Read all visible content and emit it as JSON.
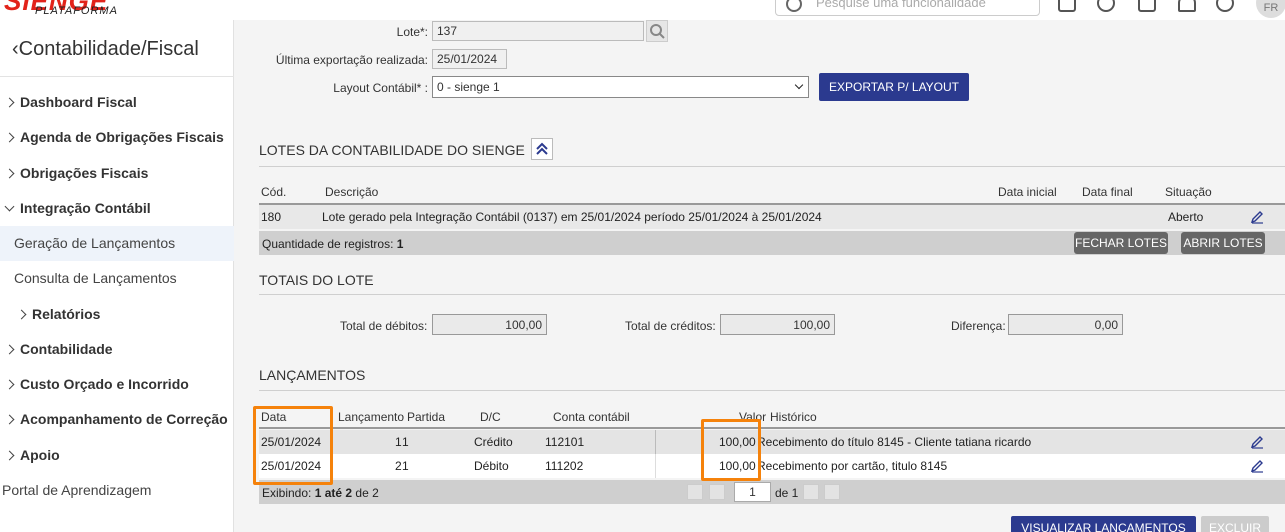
{
  "topbar": {
    "brand": "SIENGE",
    "brand_sub": "PLATAFORMA",
    "search_placeholder": "Pesquise uma funcionalidade",
    "avatar_initials": "FR"
  },
  "sidebar": {
    "title": "Contabilidade/Fiscal",
    "items": [
      {
        "label": "Dashboard Fiscal"
      },
      {
        "label": "Agenda de Obrigações Fiscais"
      },
      {
        "label": "Obrigações Fiscais"
      },
      {
        "label": "Integração Contábil"
      },
      {
        "label": "Geração de Lançamentos"
      },
      {
        "label": "Consulta de Lançamentos"
      },
      {
        "label": "Relatórios"
      },
      {
        "label": "Contabilidade"
      },
      {
        "label": "Custo Orçado e Incorrido"
      },
      {
        "label": "Acompanhamento de Correção"
      },
      {
        "label": "Apoio"
      },
      {
        "label": "Portal de Aprendizagem"
      }
    ]
  },
  "form": {
    "lote_label": "Lote*:",
    "lote_value": "137",
    "ultima_label": "Última exportação realizada:",
    "ultima_value": "25/01/2024",
    "layout_label": "Layout Contábil* :",
    "layout_value": "0 - sienge 1",
    "export_button": "EXPORTAR P/ LAYOUT"
  },
  "lotes": {
    "title": "LOTES DA CONTABILIDADE DO SIENGE",
    "headers": [
      "Cód.",
      "Descrição",
      "Data inicial",
      "Data final",
      "Situação"
    ],
    "row": {
      "cod": "180",
      "descricao": "Lote gerado pela Integração Contábil (0137) em 25/01/2024 período 25/01/2024 à 25/01/2024",
      "situacao": "Aberto"
    },
    "count_label": "Quantidade de registros:",
    "count_value": "1",
    "fechar_button": "FECHAR LOTES",
    "abrir_button": "ABRIR LOTES"
  },
  "totais": {
    "title": "TOTAIS DO LOTE",
    "debitos_label": "Total de débitos:",
    "debitos_value": "100,00",
    "creditos_label": "Total de créditos:",
    "creditos_value": "100,00",
    "diferenca_label": "Diferença:",
    "diferenca_value": "0,00"
  },
  "lancamentos": {
    "title": "LANÇAMENTOS",
    "headers": [
      "Data",
      "Lançamento",
      "Partida",
      "D/C",
      "Conta contábil",
      "Valor",
      "Histórico"
    ],
    "rows": [
      {
        "data": "25/01/2024",
        "lancamento": "1",
        "partida": "1",
        "dc": "Crédito",
        "conta": "112101",
        "valor": "100,00",
        "historico": "Recebimento do título 8145 - Cliente tatiana ricardo"
      },
      {
        "data": "25/01/2024",
        "lancamento": "2",
        "partida": "1",
        "dc": "Débito",
        "conta": "111202",
        "valor": "100,00",
        "historico": "Recebimento por cartão, titulo 8145"
      }
    ],
    "showing_prefix": "Exibindo:",
    "showing_range": "1 até 2",
    "showing_of": "de 2",
    "page_value": "1",
    "page_of": "de 1",
    "visualizar_button": "VISUALIZAR LANÇAMENTOS",
    "excluir_button": "EXCLUIR"
  },
  "colors": {
    "brand_red": "#e2231a",
    "primary_blue": "#2b3a8f",
    "highlight_orange": "#f5820b"
  }
}
